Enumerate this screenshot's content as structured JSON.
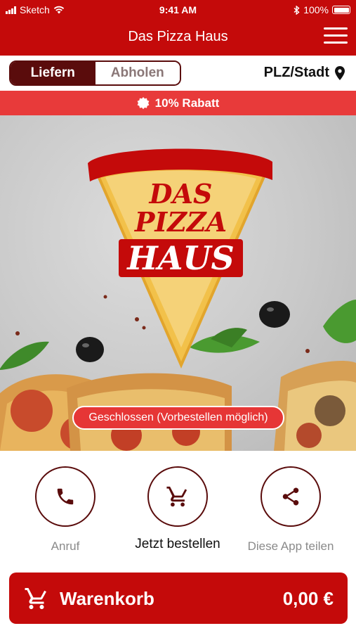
{
  "status_bar": {
    "carrier": "Sketch",
    "time": "9:41 AM",
    "battery": "100%"
  },
  "header": {
    "title": "Das Pizza Haus"
  },
  "mode": {
    "deliver": "Liefern",
    "pickup": "Abholen",
    "selected": "Liefern"
  },
  "location": {
    "label": "PLZ/Stadt"
  },
  "discount": {
    "label": "10% Rabatt"
  },
  "hero": {
    "logo_lines": [
      "DAS",
      "PIZZA",
      "HAUS"
    ],
    "status_pill": "Geschlossen (Vorbestellen möglich)"
  },
  "actions": [
    {
      "label": "Anruf",
      "icon": "phone-icon"
    },
    {
      "label": "Jetzt bestellen",
      "icon": "cart-icon"
    },
    {
      "label": "Diese App teilen",
      "icon": "share-icon"
    }
  ],
  "cart": {
    "label": "Warenkorb",
    "total": "0,00 €"
  },
  "colors": {
    "brand_red": "#c40a0a",
    "dark_red": "#5a0c0c",
    "discount_red": "#e83a3a"
  }
}
